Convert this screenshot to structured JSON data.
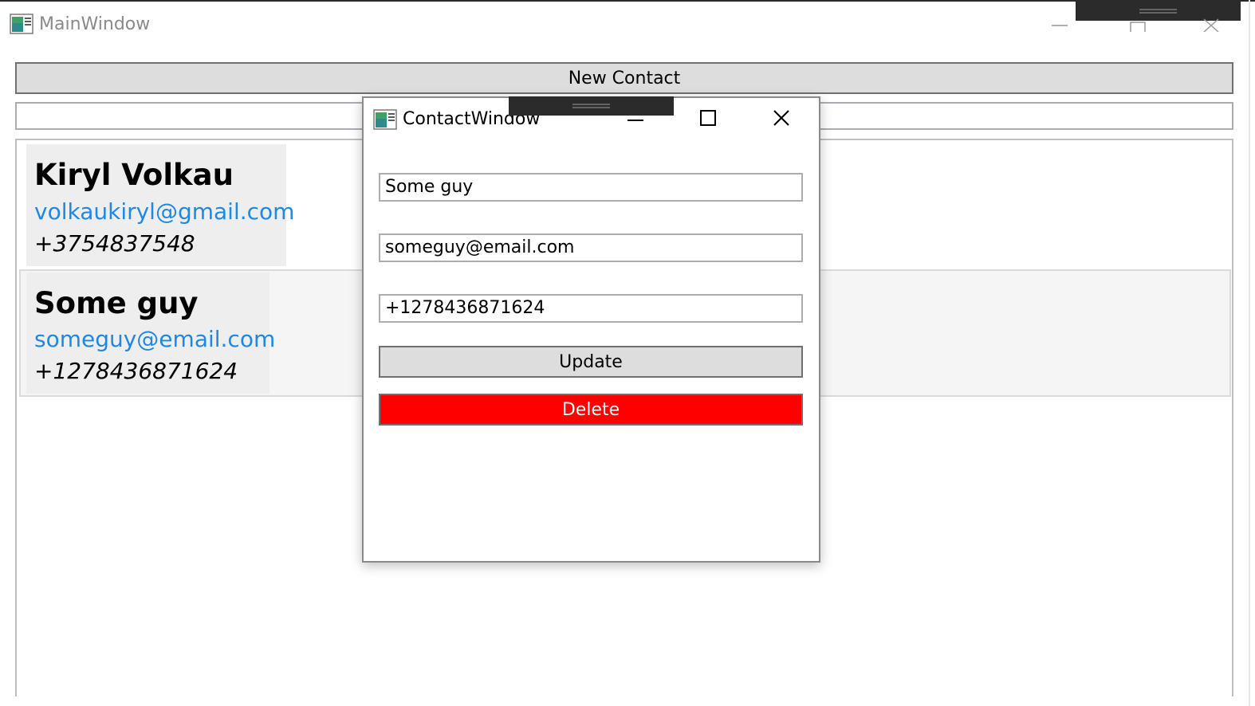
{
  "main_window": {
    "title": "MainWindow",
    "new_contact_label": "New Contact",
    "search_value": "",
    "contacts": [
      {
        "name": "Kiryl Volkau",
        "email": "volkaukiryl@gmail.com",
        "phone": "+3754837548"
      },
      {
        "name": "Some guy",
        "email": "someguy@email.com",
        "phone": "+1278436871624"
      }
    ]
  },
  "contact_window": {
    "title": "ContactWindow",
    "name_value": "Some guy",
    "email_value": "someguy@email.com",
    "phone_value": "+1278436871624",
    "update_label": "Update",
    "delete_label": "Delete"
  },
  "colors": {
    "link": "#1e88e5",
    "delete": "#ff0000",
    "button": "#dddddd",
    "card": "#eeeeee"
  },
  "icons": {
    "app": "app-window-icon",
    "minimize": "minimize-icon",
    "maximize": "maximize-icon",
    "close": "close-icon"
  }
}
